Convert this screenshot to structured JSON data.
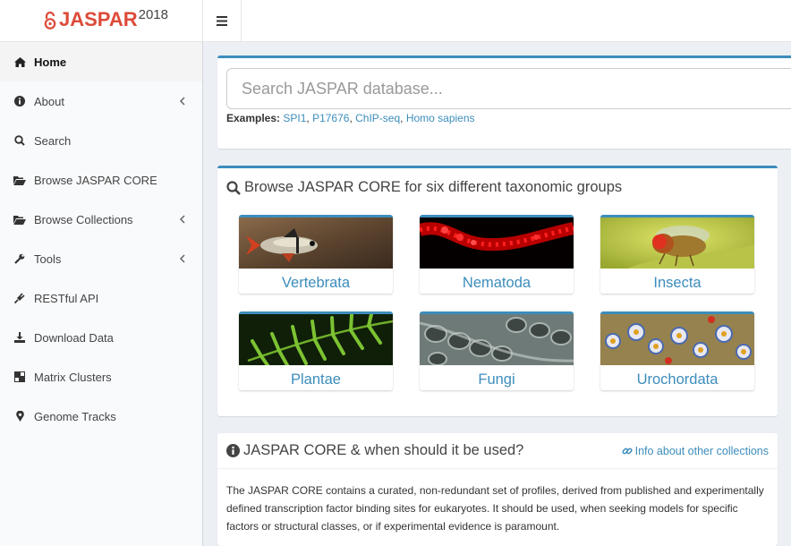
{
  "header": {
    "logo_name": "JASPAR",
    "logo_year": "2018",
    "menu_icon": "hamburger-icon"
  },
  "sidebar": {
    "items": [
      {
        "label": "Home",
        "icon": "home-icon",
        "active": true
      },
      {
        "label": "About",
        "icon": "info-circle-icon",
        "has_submenu": true
      },
      {
        "label": "Search",
        "icon": "search-icon"
      },
      {
        "label": "Browse JASPAR CORE",
        "icon": "folder-open-icon"
      },
      {
        "label": "Browse Collections",
        "icon": "folder-open-icon",
        "has_submenu": true
      },
      {
        "label": "Tools",
        "icon": "wrench-icon",
        "has_submenu": true
      },
      {
        "label": "RESTful API",
        "icon": "plug-icon"
      },
      {
        "label": "Download Data",
        "icon": "download-icon"
      },
      {
        "label": "Matrix Clusters",
        "icon": "clone-icon"
      },
      {
        "label": "Genome Tracks",
        "icon": "map-marker-icon"
      }
    ]
  },
  "search": {
    "placeholder": "Search JASPAR database...",
    "examples_label": "Examples:",
    "examples": [
      "SPI1",
      "P17676",
      "ChIP-seq",
      "Homo sapiens"
    ]
  },
  "browse": {
    "title": "Browse JASPAR CORE for six different taxonomic groups",
    "groups": [
      {
        "label": "Vertebrata"
      },
      {
        "label": "Nematoda"
      },
      {
        "label": "Insecta"
      },
      {
        "label": "Plantae"
      },
      {
        "label": "Fungi"
      },
      {
        "label": "Urochordata"
      }
    ]
  },
  "info": {
    "title": "JASPAR CORE & when should it be used?",
    "link": "Info about other collections",
    "body": "The JASPAR CORE contains a curated, non-redundant set of profiles, derived from published and experimentally defined transcription factor binding sites for eukaryotes. It should be used, when seeking models for specific factors or structural classes, or if experimental evidence is paramount."
  },
  "colors": {
    "accent": "#3c8dbc",
    "brand_red": "#dd4b39",
    "background": "#ecf0f5"
  }
}
